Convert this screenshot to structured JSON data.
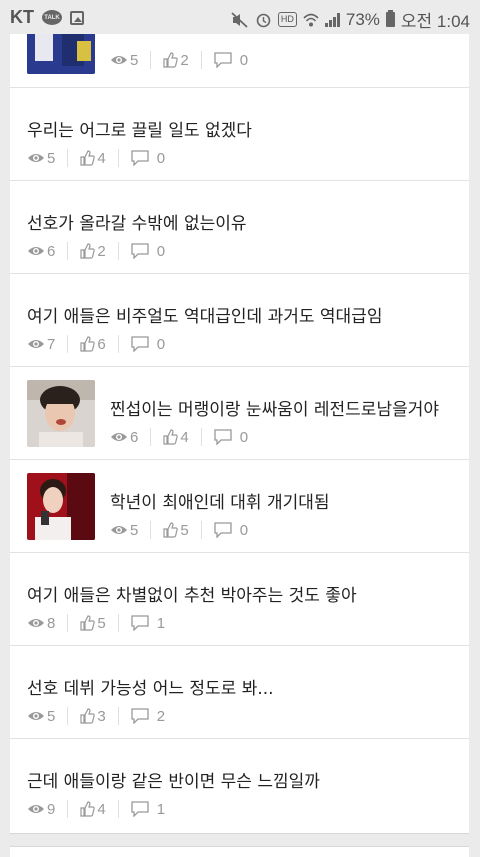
{
  "status": {
    "carrier": "KT",
    "talk": "TALK",
    "hd": "HD",
    "battery": "73%",
    "time": "오전 1:04"
  },
  "colors": {
    "meta_gray": "#999999",
    "title": "#222222",
    "divider": "#e2e2e2"
  },
  "posts": [
    {
      "title": "",
      "views": "5",
      "likes": "2",
      "comments": "0",
      "thumb": "sports-photo"
    },
    {
      "title": "우리는 어그로 끌릴 일도 없겠다",
      "views": "5",
      "likes": "4",
      "comments": "0"
    },
    {
      "title": "선호가 올라갈 수밖에 없는이유",
      "views": "6",
      "likes": "2",
      "comments": "0"
    },
    {
      "title": "여기 애들은 비주얼도 역대급인데 과거도 역대급임",
      "views": "7",
      "likes": "6",
      "comments": "0"
    },
    {
      "title": "찐섭이는 머랭이랑 눈싸움이 레전드로남을거야",
      "views": "6",
      "likes": "4",
      "comments": "0",
      "thumb": "boy-portrait"
    },
    {
      "title": "학년이 최애인데 대휘 개기대됨",
      "views": "5",
      "likes": "5",
      "comments": "0",
      "thumb": "red-stage-photo"
    },
    {
      "title": "여기 애들은 차별없이 추천 박아주는 것도 좋아",
      "views": "8",
      "likes": "5",
      "comments": "1"
    },
    {
      "title": "선호 데뷔 가능성 어느 정도로 봐...",
      "views": "5",
      "likes": "3",
      "comments": "2"
    },
    {
      "title": "근데 애들이랑 같은 반이면 무슨 느낌일까",
      "views": "9",
      "likes": "4",
      "comments": "1"
    }
  ]
}
